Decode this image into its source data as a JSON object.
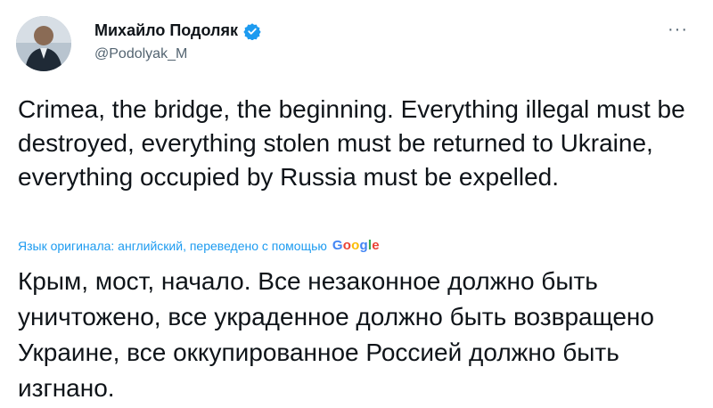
{
  "author": {
    "display_name": "Михайло Подоляк",
    "handle": "@Podolyak_M",
    "verified_icon": "verified-badge-icon"
  },
  "menu": {
    "more_label": "···"
  },
  "tweet": {
    "text_en": "Crimea, the bridge, the beginning. Everything illegal must be destroyed, everything stolen must be returned to Ukraine, everything occupied by Russia must be expelled.",
    "translation_note": "Язык оригинала: английский, переведено с помощью",
    "translation_provider": [
      "G",
      "o",
      "o",
      "g",
      "l",
      "e"
    ],
    "text_ru": "Крым, мост, начало. Все незаконное должно быть уничтожено, все украденное должно быть возвращено Украине, все оккупированное Россией должно быть изгнано."
  },
  "colors": {
    "accent": "#1d9bf0",
    "text": "#0f1419",
    "secondary": "#536471"
  }
}
